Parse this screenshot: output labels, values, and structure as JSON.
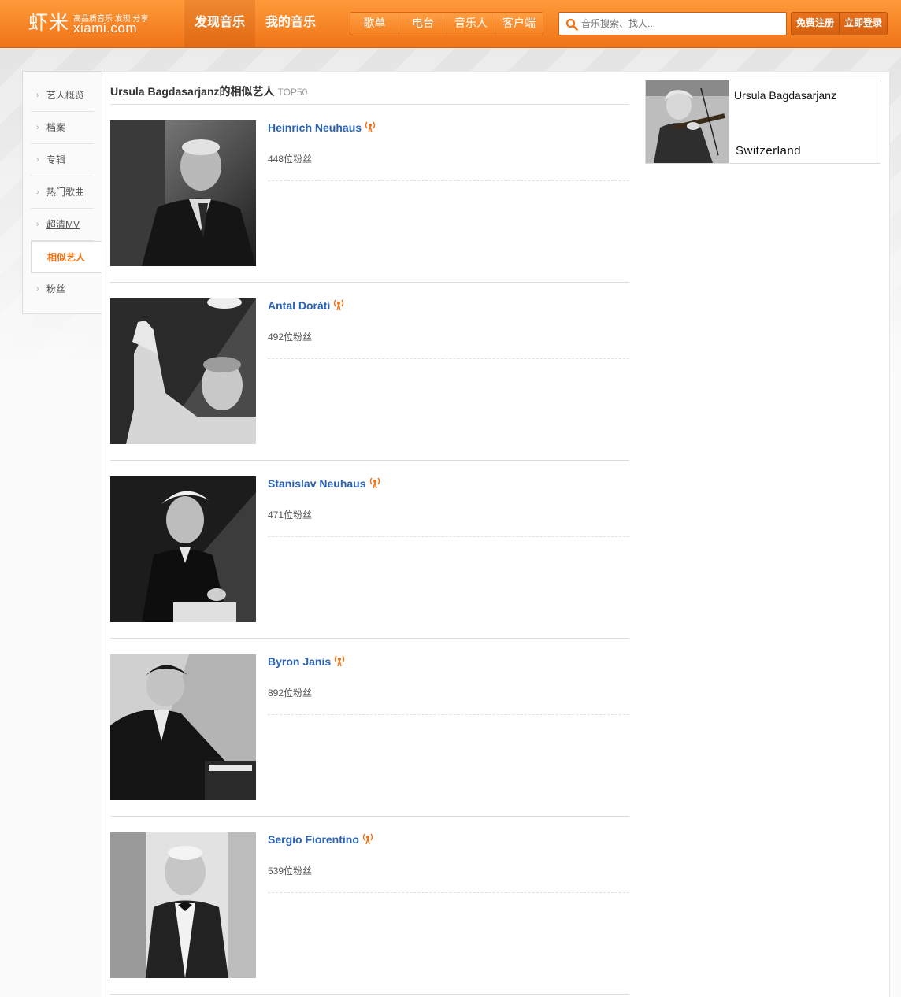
{
  "header": {
    "logo": {
      "cn": "虾米",
      "slogan": "高品质音乐 发现 分享",
      "domain": "xiami.com"
    },
    "main_nav": [
      {
        "label": "发现音乐",
        "active": true
      },
      {
        "label": "我的音乐",
        "active": false
      }
    ],
    "sub_nav": [
      "歌单",
      "电台",
      "音乐人",
      "客户端"
    ],
    "search": {
      "placeholder": "音乐搜索、找人..."
    },
    "auth": {
      "register": "免费注册",
      "login": "立即登录"
    }
  },
  "sidebar": {
    "items": [
      {
        "label": "艺人概览"
      },
      {
        "label": "档案"
      },
      {
        "label": "专辑"
      },
      {
        "label": "热门歌曲"
      },
      {
        "label": "超清MV"
      },
      {
        "label": "相似艺人",
        "active": true
      },
      {
        "label": "粉丝"
      }
    ]
  },
  "main": {
    "title": "Ursula Bagdasarjanz的相似艺人",
    "subtitle": "TOP50",
    "artists": [
      {
        "name": "Heinrich Neuhaus",
        "fans": "448位粉丝"
      },
      {
        "name": "Antal Doráti",
        "fans": "492位粉丝"
      },
      {
        "name": "Stanislav Neuhaus",
        "fans": "471位粉丝"
      },
      {
        "name": "Byron Janis",
        "fans": "892位粉丝"
      },
      {
        "name": "Sergio Fiorentino",
        "fans": "539位粉丝"
      }
    ]
  },
  "profile": {
    "name": "Ursula Bagdasarjanz",
    "country": "Switzerland"
  },
  "colors": {
    "brand_orange": "#f58220",
    "link_blue": "#2a62b8",
    "active_orange": "#f06f0a"
  },
  "icons": {
    "search": "search-icon",
    "radio": "radio-icon",
    "chevron": "chevron-right-icon"
  }
}
